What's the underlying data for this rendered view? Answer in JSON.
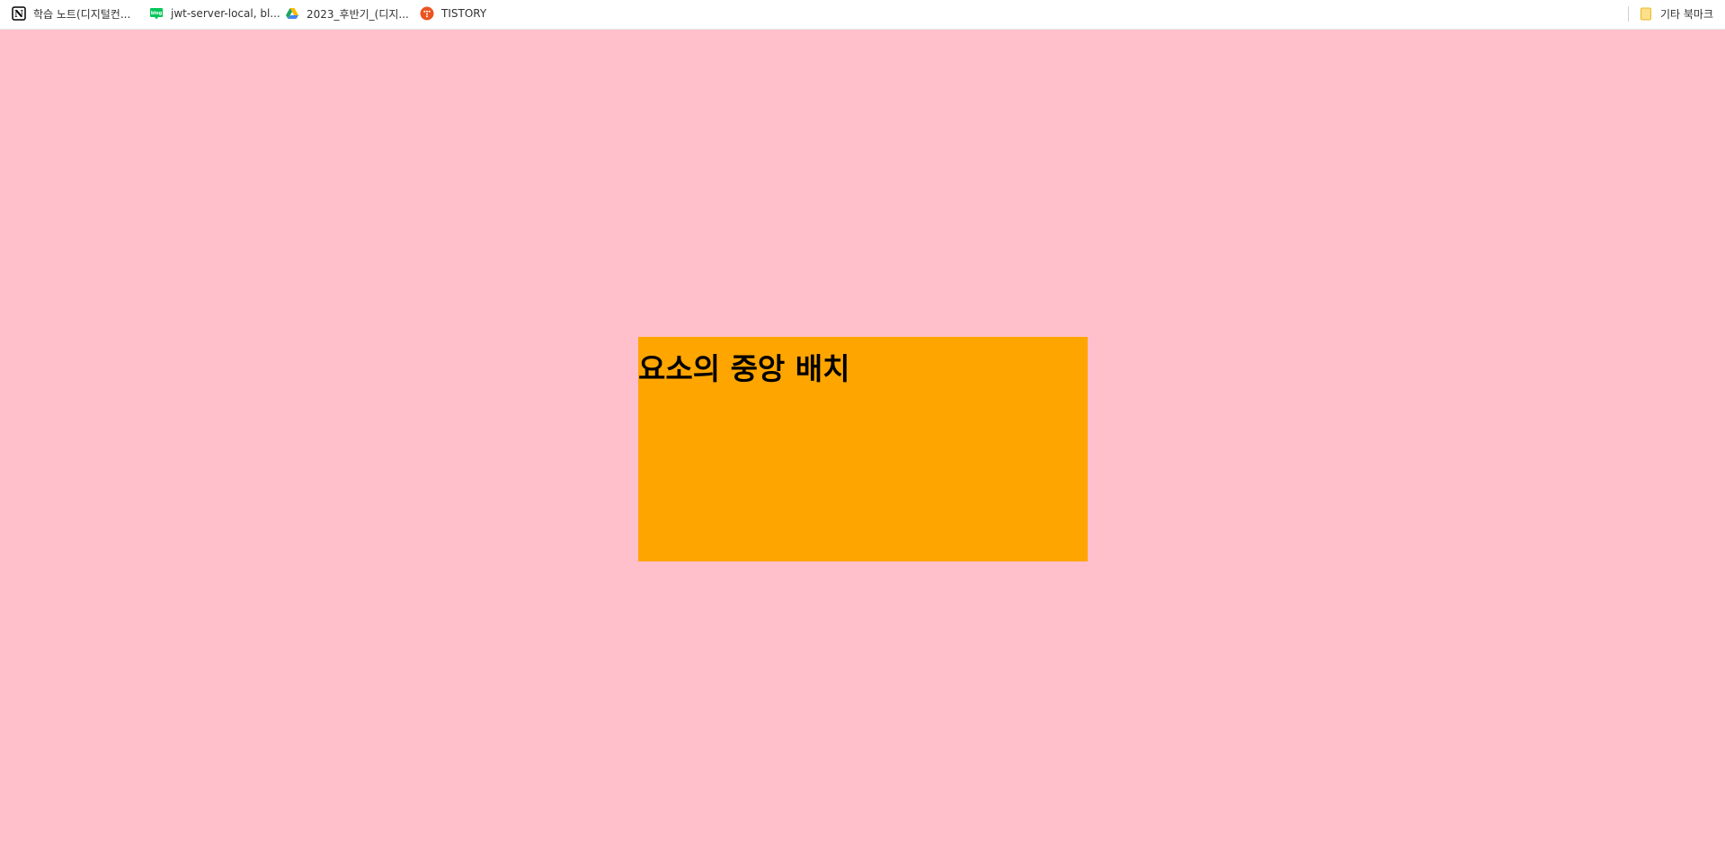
{
  "bookmarks": [
    {
      "label": "학습 노트(디지털컨...",
      "icon": "notion-icon"
    },
    {
      "label": "jwt-server-local, bl...",
      "icon": "blog-icon"
    },
    {
      "label": "2023_후반기_(디지...",
      "icon": "google-drive-icon"
    },
    {
      "label": "TISTORY",
      "icon": "tistory-icon"
    }
  ],
  "other_bookmarks": {
    "label": "기타 북마크",
    "icon": "folder-icon"
  },
  "page": {
    "heading": "요소의 중앙 배치",
    "background_color": "#ffc0cb",
    "box_color": "#ffa500"
  }
}
